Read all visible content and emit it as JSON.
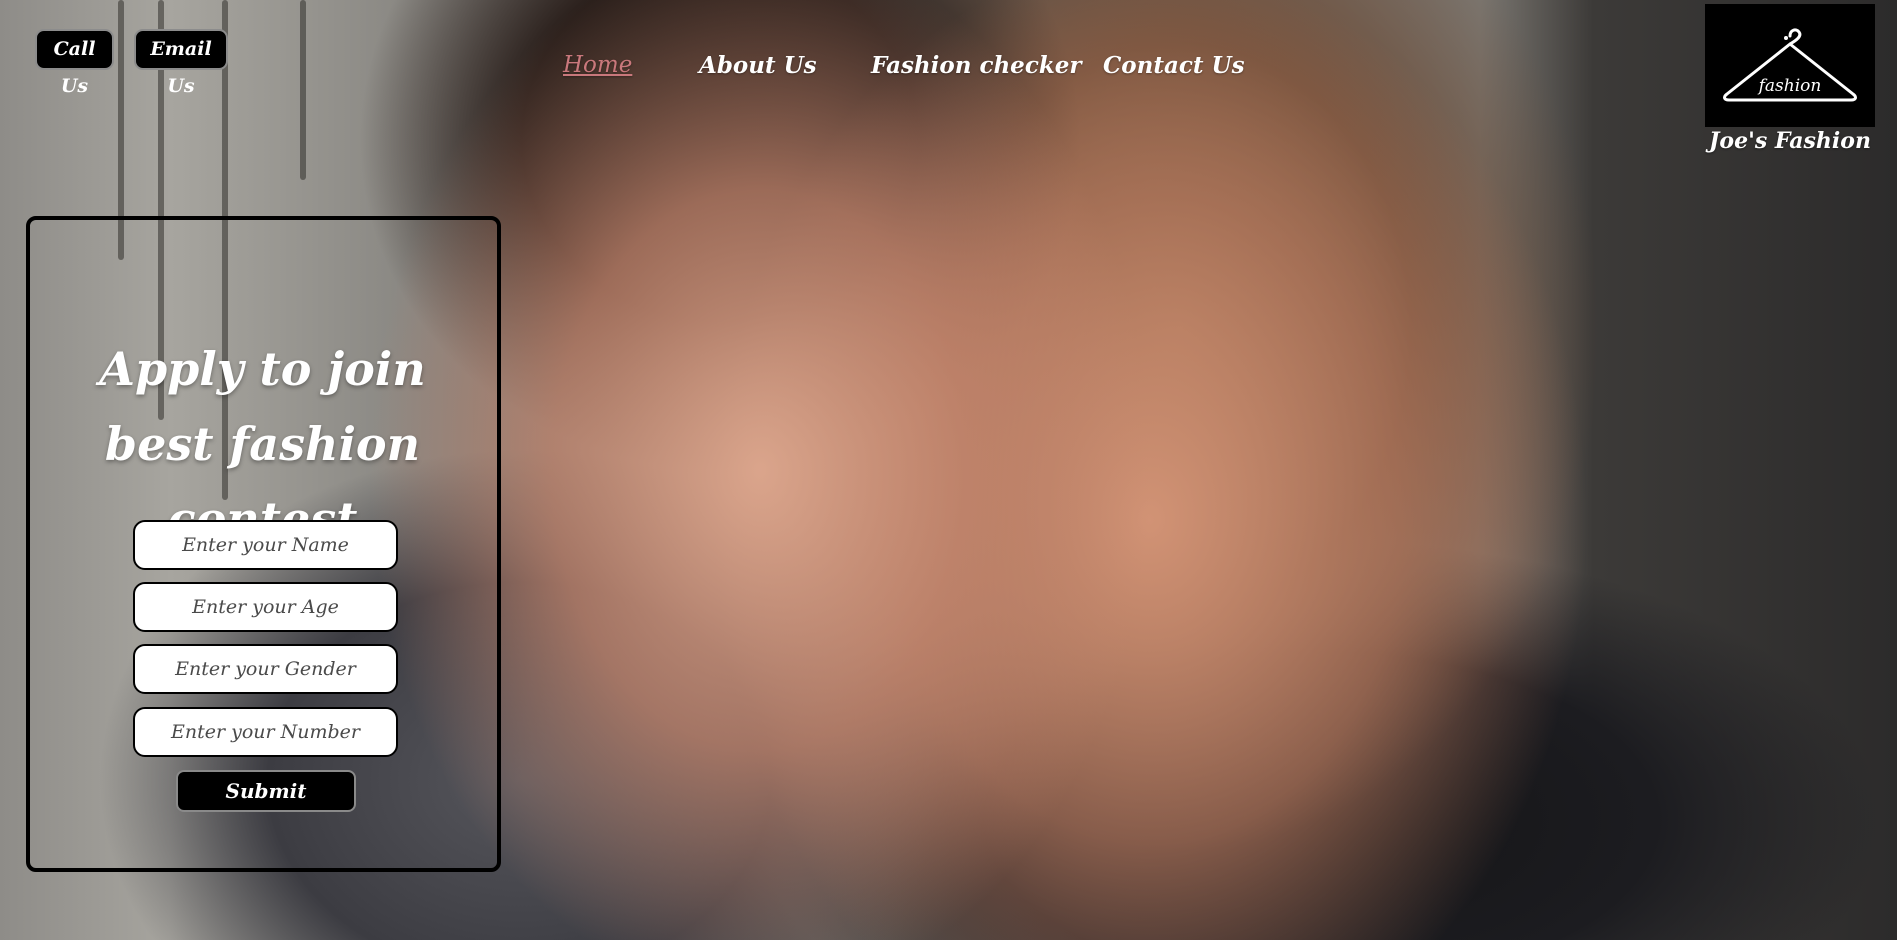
{
  "header": {
    "call_label": "Call Us",
    "email_label": "Email Us"
  },
  "nav": {
    "items": [
      {
        "label": "Home",
        "active": true
      },
      {
        "label": "About Us",
        "active": false
      },
      {
        "label": "Fashion checker",
        "active": false
      },
      {
        "label": "Contact Us",
        "active": false
      }
    ]
  },
  "brand": {
    "logo_text": "fashion",
    "name": "Joe's Fashion"
  },
  "form": {
    "title": "Apply to join best fashion contest",
    "name_placeholder": "Enter your Name",
    "age_placeholder": "Enter your Age",
    "gender_placeholder": "Enter your Gender",
    "number_placeholder": "Enter your Number",
    "submit_label": "Submit"
  },
  "colors": {
    "active_nav": "#c9787c",
    "button_bg": "#000000",
    "text": "#ffffff"
  },
  "icons": [
    "hanger-logo-icon"
  ]
}
